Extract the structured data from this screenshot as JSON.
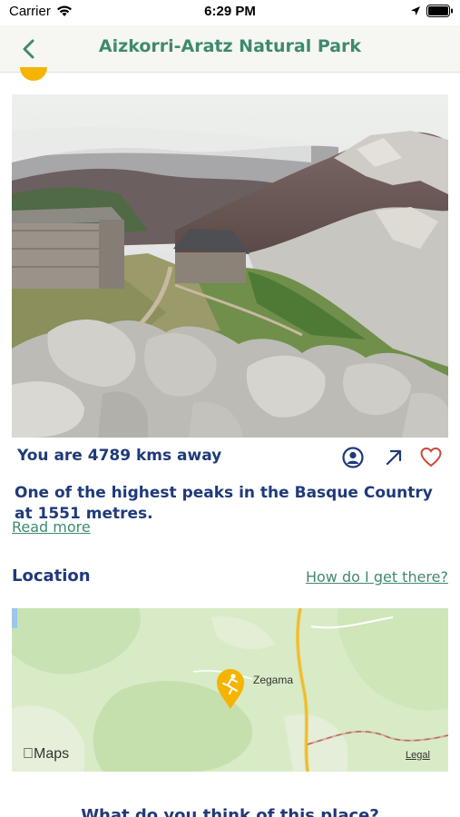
{
  "status_bar": {
    "carrier": "Carrier",
    "time": "6:29 PM"
  },
  "nav": {
    "title": "Aizkorri-Aratz Natural Park"
  },
  "place": {
    "distance": "You are 4789 kms away",
    "description": "One of the highest peaks in the Basque Country at 1551 metres.",
    "read_more": "Read more"
  },
  "location": {
    "heading": "Location",
    "directions_link": "How do I get there?",
    "map_town": "Zegama",
    "maps_logo": "Maps",
    "maps_legal": "Legal"
  },
  "feedback": {
    "question": "What do you think of this place?"
  },
  "colors": {
    "brand_green": "#3f8a6e",
    "text_navy": "#1f3a7a",
    "marker_yellow": "#f5b400",
    "favorite_red": "#d0453a"
  },
  "icons": [
    "wifi-icon",
    "location-arrow-icon",
    "battery-icon",
    "back-icon",
    "user-icon",
    "share-arrow-icon",
    "heart-icon",
    "map-marker-icon"
  ]
}
